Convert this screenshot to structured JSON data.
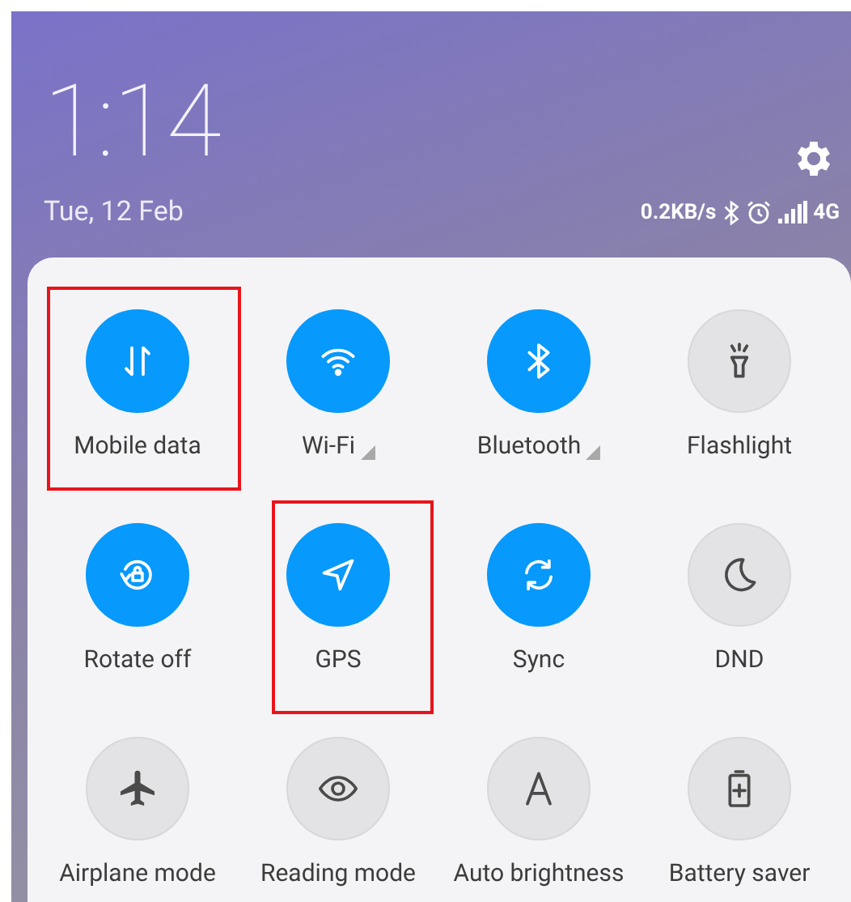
{
  "clock": {
    "time": "1:14",
    "date": "Tue, 12 Feb"
  },
  "status_bar": {
    "speed": "0.2KB/s",
    "network": "4G"
  },
  "tiles": [
    {
      "label": "Mobile data",
      "on": true,
      "has_menu": false,
      "highlighted": true
    },
    {
      "label": "Wi-Fi",
      "on": true,
      "has_menu": true,
      "highlighted": false
    },
    {
      "label": "Bluetooth",
      "on": true,
      "has_menu": true,
      "highlighted": false
    },
    {
      "label": "Flashlight",
      "on": false,
      "has_menu": false,
      "highlighted": false
    },
    {
      "label": "Rotate off",
      "on": true,
      "has_menu": false,
      "highlighted": false
    },
    {
      "label": "GPS",
      "on": true,
      "has_menu": false,
      "highlighted": true
    },
    {
      "label": "Sync",
      "on": true,
      "has_menu": false,
      "highlighted": false
    },
    {
      "label": "DND",
      "on": false,
      "has_menu": false,
      "highlighted": false
    },
    {
      "label": "Airplane mode",
      "on": false,
      "has_menu": false,
      "highlighted": false
    },
    {
      "label": "Reading mode",
      "on": false,
      "has_menu": false,
      "highlighted": false
    },
    {
      "label": "Auto brightness",
      "on": false,
      "has_menu": false,
      "highlighted": false
    },
    {
      "label": "Battery saver",
      "on": false,
      "has_menu": false,
      "highlighted": false
    }
  ]
}
